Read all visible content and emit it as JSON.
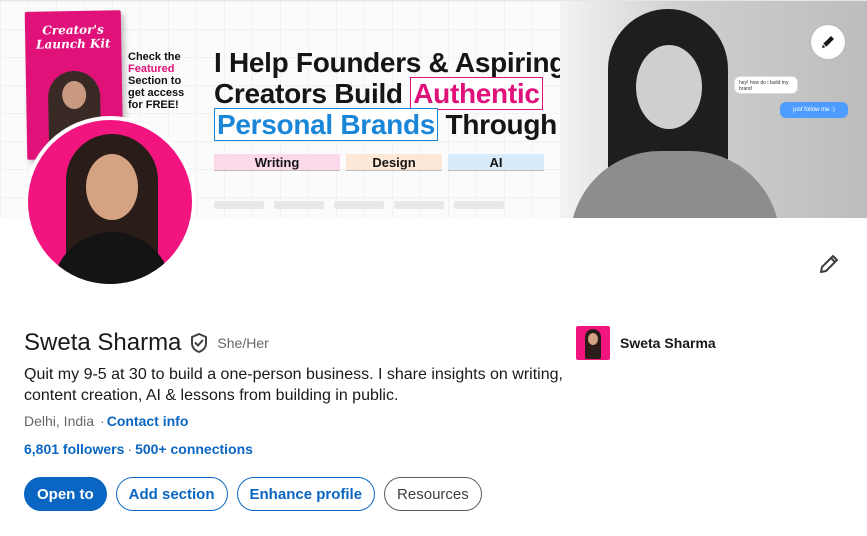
{
  "banner": {
    "book_title_line1": "Creator's",
    "book_title_line2": "Launch Kit",
    "check_line1": "Check the",
    "check_accent": "Featured",
    "check_line3": "Section to",
    "check_line4": "get access",
    "check_line5": "for FREE!",
    "headline_part1": "I Help Founders & Aspiring",
    "headline_part2": "Creators Build ",
    "headline_pink": "Authentic",
    "headline_blue": "Personal Brands",
    "headline_part3": " Through",
    "pills": [
      "Writing",
      "Design",
      "AI"
    ],
    "bubble1": "hey! how do i build my brand",
    "bubble2": "just follow me :)",
    "edit_icon": "pencil-icon"
  },
  "profile": {
    "name": "Sweta Sharma",
    "verified_icon": "verified-shield-icon",
    "pronouns": "She/Her",
    "headline": "Quit my 9-5 at 30 to build a one-person business. I share insights on writing, content creation, AI & lessons from building in public.",
    "location": "Delhi, India",
    "location_sep": "·",
    "contact_info": "Contact info",
    "followers": "6,801 followers",
    "net_sep": "·",
    "connections": "500+ connections"
  },
  "company": {
    "name": "Sweta Sharma"
  },
  "actions": {
    "open_to": "Open to",
    "add_section": "Add section",
    "enhance_profile": "Enhance profile",
    "resources": "Resources"
  },
  "colors": {
    "brand_blue": "#0a66c2",
    "accent_pink": "#f2157f"
  }
}
